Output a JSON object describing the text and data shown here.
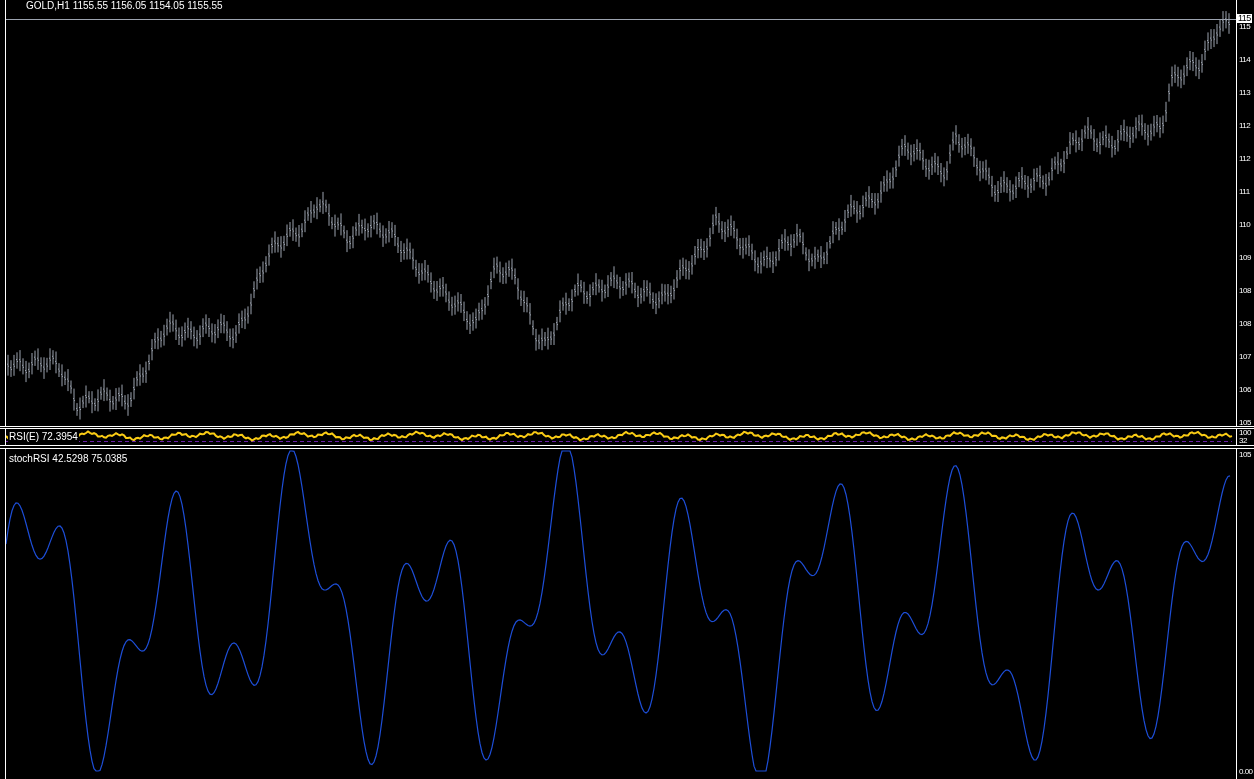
{
  "chart_title": "GOLD,H1  1155.55 1156.05 1154.05 1155.55",
  "price_axis": [
    {
      "label": "115",
      "kind": "current"
    },
    {
      "label": "115",
      "kind": "tick"
    },
    {
      "label": "114",
      "kind": "tick"
    },
    {
      "label": "113",
      "kind": "tick"
    },
    {
      "label": "112",
      "kind": "tick"
    },
    {
      "label": "112",
      "kind": "tick"
    },
    {
      "label": "111",
      "kind": "tick"
    },
    {
      "label": "110",
      "kind": "tick"
    },
    {
      "label": "109",
      "kind": "tick"
    },
    {
      "label": "108",
      "kind": "tick"
    },
    {
      "label": "108",
      "kind": "tick"
    },
    {
      "label": "107",
      "kind": "tick"
    },
    {
      "label": "106",
      "kind": "tick"
    },
    {
      "label": "105",
      "kind": "tick"
    }
  ],
  "rsi_pane": {
    "label": "RSI(E) 72.3954",
    "axis": [
      "100",
      "32"
    ]
  },
  "stoch_pane": {
    "label": "stochRSI 42.5298 75.0385",
    "axis": [
      "105",
      "0.00"
    ]
  }
}
